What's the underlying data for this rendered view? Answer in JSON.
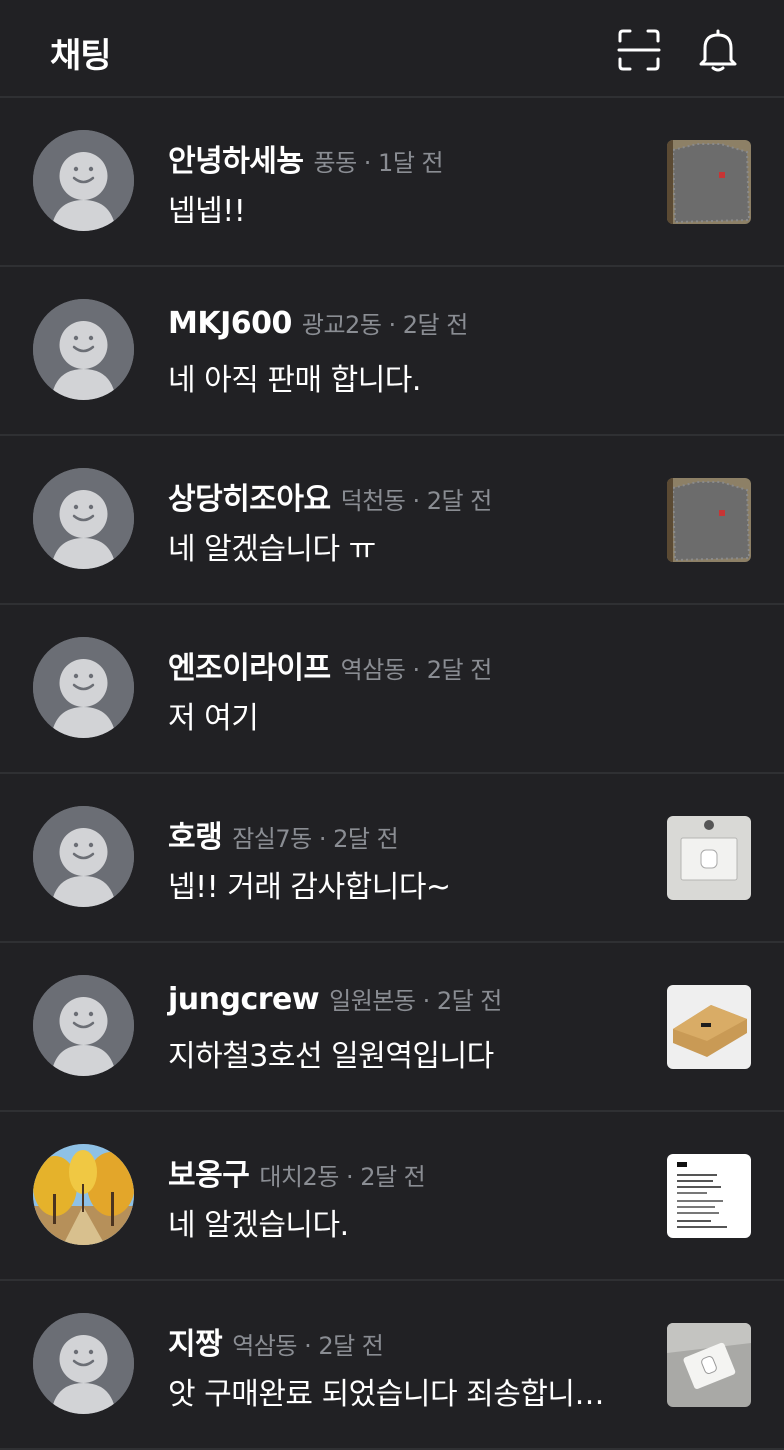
{
  "header": {
    "title": "채팅",
    "scan_icon": "qr-scan-icon",
    "bell_icon": "bell-icon"
  },
  "colors": {
    "background": "#212124",
    "divider": "#2f3033",
    "meta_text": "#8a8d93",
    "avatar_placeholder": "#6b6e75"
  },
  "chats": [
    {
      "name": "안녕하세뇽",
      "meta": "풍동 · 1달 전",
      "message": "넵넵!!",
      "avatar": "default",
      "thumbnail": "gray-knit-sweater"
    },
    {
      "name": "MKJ600",
      "meta": "광교2동 · 2달 전",
      "message": "네 아직 판매 합니다.",
      "avatar": "default",
      "thumbnail": null
    },
    {
      "name": "상당히조아요",
      "meta": "덕천동 · 2달 전",
      "message": "네 알겠습니다 ㅠ",
      "avatar": "default",
      "thumbnail": "gray-knit-sweater"
    },
    {
      "name": "엔조이라이프",
      "meta": "역삼동 · 2달 전",
      "message": "저 여기",
      "avatar": "default",
      "thumbnail": null
    },
    {
      "name": "호랭",
      "meta": "잠실7동 · 2달 전",
      "message": "넵!! 거래 감사합니다~",
      "avatar": "default",
      "thumbnail": "airpods-box"
    },
    {
      "name": "jungcrew",
      "meta": "일원본동 · 2달 전",
      "message": "지하철3호선 일원역입니다",
      "avatar": "default",
      "thumbnail": "cardboard-box"
    },
    {
      "name": "보옹구",
      "meta": "대치2동 · 2달 전",
      "message": "네 알겠습니다.",
      "avatar": "autumn-trees-photo",
      "thumbnail": "receipt-document"
    },
    {
      "name": "지짱",
      "meta": "역삼동 · 2달 전",
      "message": "앗 구매완료 되었습니다 죄송합니…",
      "avatar": "default",
      "thumbnail": "airpods-case"
    }
  ]
}
